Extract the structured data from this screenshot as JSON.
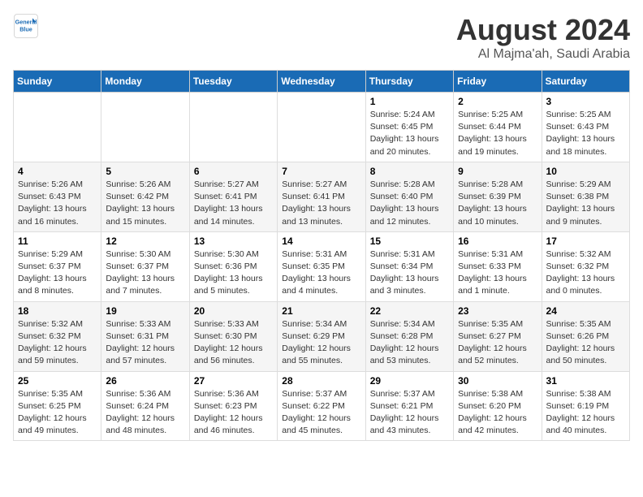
{
  "header": {
    "logo_line1": "General",
    "logo_line2": "Blue",
    "main_title": "August 2024",
    "sub_title": "Al Majma'ah, Saudi Arabia"
  },
  "calendar": {
    "days_of_week": [
      "Sunday",
      "Monday",
      "Tuesday",
      "Wednesday",
      "Thursday",
      "Friday",
      "Saturday"
    ],
    "weeks": [
      [
        {
          "day": "",
          "info": ""
        },
        {
          "day": "",
          "info": ""
        },
        {
          "day": "",
          "info": ""
        },
        {
          "day": "",
          "info": ""
        },
        {
          "day": "1",
          "info": "Sunrise: 5:24 AM\nSunset: 6:45 PM\nDaylight: 13 hours\nand 20 minutes."
        },
        {
          "day": "2",
          "info": "Sunrise: 5:25 AM\nSunset: 6:44 PM\nDaylight: 13 hours\nand 19 minutes."
        },
        {
          "day": "3",
          "info": "Sunrise: 5:25 AM\nSunset: 6:43 PM\nDaylight: 13 hours\nand 18 minutes."
        }
      ],
      [
        {
          "day": "4",
          "info": "Sunrise: 5:26 AM\nSunset: 6:43 PM\nDaylight: 13 hours\nand 16 minutes."
        },
        {
          "day": "5",
          "info": "Sunrise: 5:26 AM\nSunset: 6:42 PM\nDaylight: 13 hours\nand 15 minutes."
        },
        {
          "day": "6",
          "info": "Sunrise: 5:27 AM\nSunset: 6:41 PM\nDaylight: 13 hours\nand 14 minutes."
        },
        {
          "day": "7",
          "info": "Sunrise: 5:27 AM\nSunset: 6:41 PM\nDaylight: 13 hours\nand 13 minutes."
        },
        {
          "day": "8",
          "info": "Sunrise: 5:28 AM\nSunset: 6:40 PM\nDaylight: 13 hours\nand 12 minutes."
        },
        {
          "day": "9",
          "info": "Sunrise: 5:28 AM\nSunset: 6:39 PM\nDaylight: 13 hours\nand 10 minutes."
        },
        {
          "day": "10",
          "info": "Sunrise: 5:29 AM\nSunset: 6:38 PM\nDaylight: 13 hours\nand 9 minutes."
        }
      ],
      [
        {
          "day": "11",
          "info": "Sunrise: 5:29 AM\nSunset: 6:37 PM\nDaylight: 13 hours\nand 8 minutes."
        },
        {
          "day": "12",
          "info": "Sunrise: 5:30 AM\nSunset: 6:37 PM\nDaylight: 13 hours\nand 7 minutes."
        },
        {
          "day": "13",
          "info": "Sunrise: 5:30 AM\nSunset: 6:36 PM\nDaylight: 13 hours\nand 5 minutes."
        },
        {
          "day": "14",
          "info": "Sunrise: 5:31 AM\nSunset: 6:35 PM\nDaylight: 13 hours\nand 4 minutes."
        },
        {
          "day": "15",
          "info": "Sunrise: 5:31 AM\nSunset: 6:34 PM\nDaylight: 13 hours\nand 3 minutes."
        },
        {
          "day": "16",
          "info": "Sunrise: 5:31 AM\nSunset: 6:33 PM\nDaylight: 13 hours\nand 1 minute."
        },
        {
          "day": "17",
          "info": "Sunrise: 5:32 AM\nSunset: 6:32 PM\nDaylight: 13 hours\nand 0 minutes."
        }
      ],
      [
        {
          "day": "18",
          "info": "Sunrise: 5:32 AM\nSunset: 6:32 PM\nDaylight: 12 hours\nand 59 minutes."
        },
        {
          "day": "19",
          "info": "Sunrise: 5:33 AM\nSunset: 6:31 PM\nDaylight: 12 hours\nand 57 minutes."
        },
        {
          "day": "20",
          "info": "Sunrise: 5:33 AM\nSunset: 6:30 PM\nDaylight: 12 hours\nand 56 minutes."
        },
        {
          "day": "21",
          "info": "Sunrise: 5:34 AM\nSunset: 6:29 PM\nDaylight: 12 hours\nand 55 minutes."
        },
        {
          "day": "22",
          "info": "Sunrise: 5:34 AM\nSunset: 6:28 PM\nDaylight: 12 hours\nand 53 minutes."
        },
        {
          "day": "23",
          "info": "Sunrise: 5:35 AM\nSunset: 6:27 PM\nDaylight: 12 hours\nand 52 minutes."
        },
        {
          "day": "24",
          "info": "Sunrise: 5:35 AM\nSunset: 6:26 PM\nDaylight: 12 hours\nand 50 minutes."
        }
      ],
      [
        {
          "day": "25",
          "info": "Sunrise: 5:35 AM\nSunset: 6:25 PM\nDaylight: 12 hours\nand 49 minutes."
        },
        {
          "day": "26",
          "info": "Sunrise: 5:36 AM\nSunset: 6:24 PM\nDaylight: 12 hours\nand 48 minutes."
        },
        {
          "day": "27",
          "info": "Sunrise: 5:36 AM\nSunset: 6:23 PM\nDaylight: 12 hours\nand 46 minutes."
        },
        {
          "day": "28",
          "info": "Sunrise: 5:37 AM\nSunset: 6:22 PM\nDaylight: 12 hours\nand 45 minutes."
        },
        {
          "day": "29",
          "info": "Sunrise: 5:37 AM\nSunset: 6:21 PM\nDaylight: 12 hours\nand 43 minutes."
        },
        {
          "day": "30",
          "info": "Sunrise: 5:38 AM\nSunset: 6:20 PM\nDaylight: 12 hours\nand 42 minutes."
        },
        {
          "day": "31",
          "info": "Sunrise: 5:38 AM\nSunset: 6:19 PM\nDaylight: 12 hours\nand 40 minutes."
        }
      ]
    ]
  }
}
